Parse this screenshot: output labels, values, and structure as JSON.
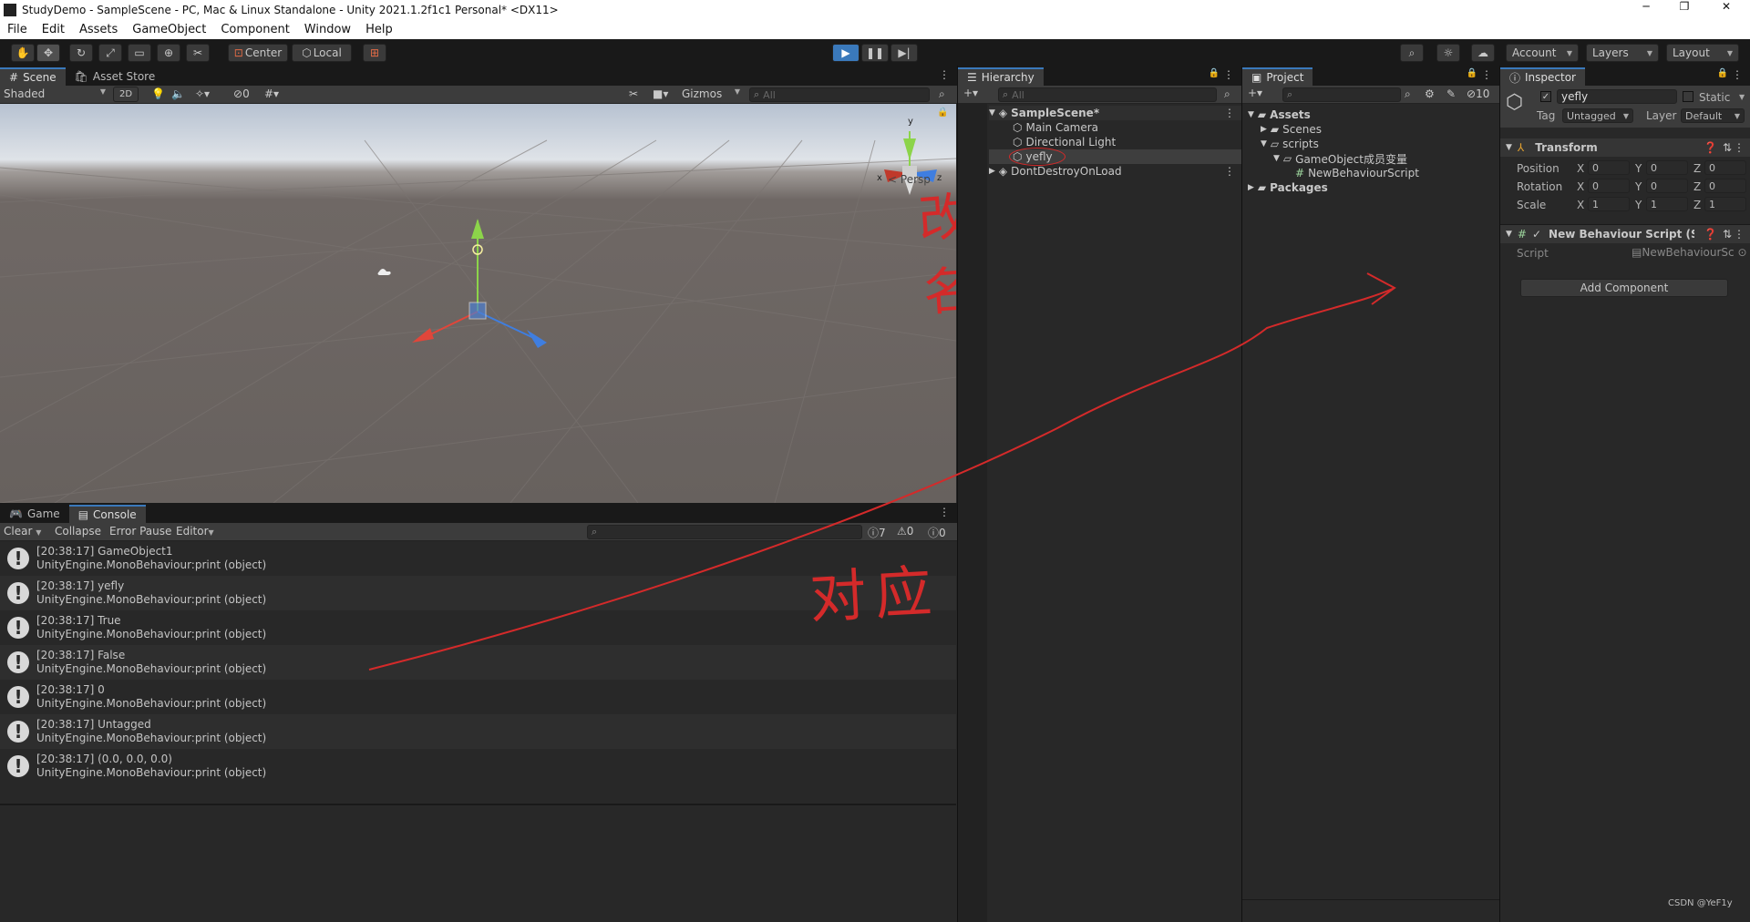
{
  "window": {
    "title": "StudyDemo - SampleScene - PC, Mac & Linux Standalone - Unity 2021.1.2f1c1 Personal* <DX11>"
  },
  "menu": [
    "File",
    "Edit",
    "Assets",
    "GameObject",
    "Component",
    "Window",
    "Help"
  ],
  "toolbar": {
    "pivot_label": "Center",
    "space_label": "Local",
    "account_label": "Account",
    "layers_label": "Layers",
    "layout_label": "Layout"
  },
  "scene": {
    "tabs": [
      "Scene",
      "Asset Store"
    ],
    "shading": "Shaded",
    "mode_2d": "2D",
    "hidden_count": "0",
    "gizmos_label": "Gizmos",
    "search_placeholder": "All",
    "persp_label": "Persp",
    "annotation": "改名"
  },
  "console": {
    "tabs": [
      "Game",
      "Console"
    ],
    "buttons": [
      "Clear",
      "Collapse",
      "Error Pause",
      "Editor"
    ],
    "counts": {
      "info": "7",
      "warn": "0",
      "error": "0"
    },
    "annotation": "对应",
    "entries": [
      {
        "line1": "[20:38:17] GameObject1",
        "line2": "UnityEngine.MonoBehaviour:print (object)"
      },
      {
        "line1": "[20:38:17] yefly",
        "line2": "UnityEngine.MonoBehaviour:print (object)"
      },
      {
        "line1": "[20:38:17] True",
        "line2": "UnityEngine.MonoBehaviour:print (object)"
      },
      {
        "line1": "[20:38:17] False",
        "line2": "UnityEngine.MonoBehaviour:print (object)"
      },
      {
        "line1": "[20:38:17] 0",
        "line2": "UnityEngine.MonoBehaviour:print (object)"
      },
      {
        "line1": "[20:38:17] Untagged",
        "line2": "UnityEngine.MonoBehaviour:print (object)"
      },
      {
        "line1": "[20:38:17] (0.0, 0.0, 0.0)",
        "line2": "UnityEngine.MonoBehaviour:print (object)"
      }
    ]
  },
  "hierarchy": {
    "title": "Hierarchy",
    "search_placeholder": "All",
    "scene_name": "SampleScene*",
    "objects": [
      "Main Camera",
      "Directional Light",
      "yefly"
    ],
    "dont_destroy": "DontDestroyOnLoad"
  },
  "project": {
    "title": "Project",
    "hidden_count": "10",
    "assets": "Assets",
    "scenes": "Scenes",
    "scripts": "scripts",
    "gameobject_folder": "GameObject成员变量",
    "script_file": "NewBehaviourScript",
    "packages": "Packages"
  },
  "inspector": {
    "title": "Inspector",
    "object_name": "yefly",
    "static_label": "Static",
    "tag_label": "Tag",
    "tag_value": "Untagged",
    "layer_label": "Layer",
    "layer_value": "Default",
    "transform_title": "Transform",
    "position_label": "Position",
    "rotation_label": "Rotation",
    "scale_label": "Scale",
    "position": {
      "x": "0",
      "y": "0",
      "z": "0"
    },
    "rotation": {
      "x": "0",
      "y": "0",
      "z": "0"
    },
    "scale": {
      "x": "1",
      "y": "1",
      "z": "1"
    },
    "component_title": "New Behaviour Script (Sc",
    "script_label": "Script",
    "script_value": "NewBehaviourSc",
    "add_component": "Add Component"
  },
  "watermark": "CSDN @YeF1y"
}
